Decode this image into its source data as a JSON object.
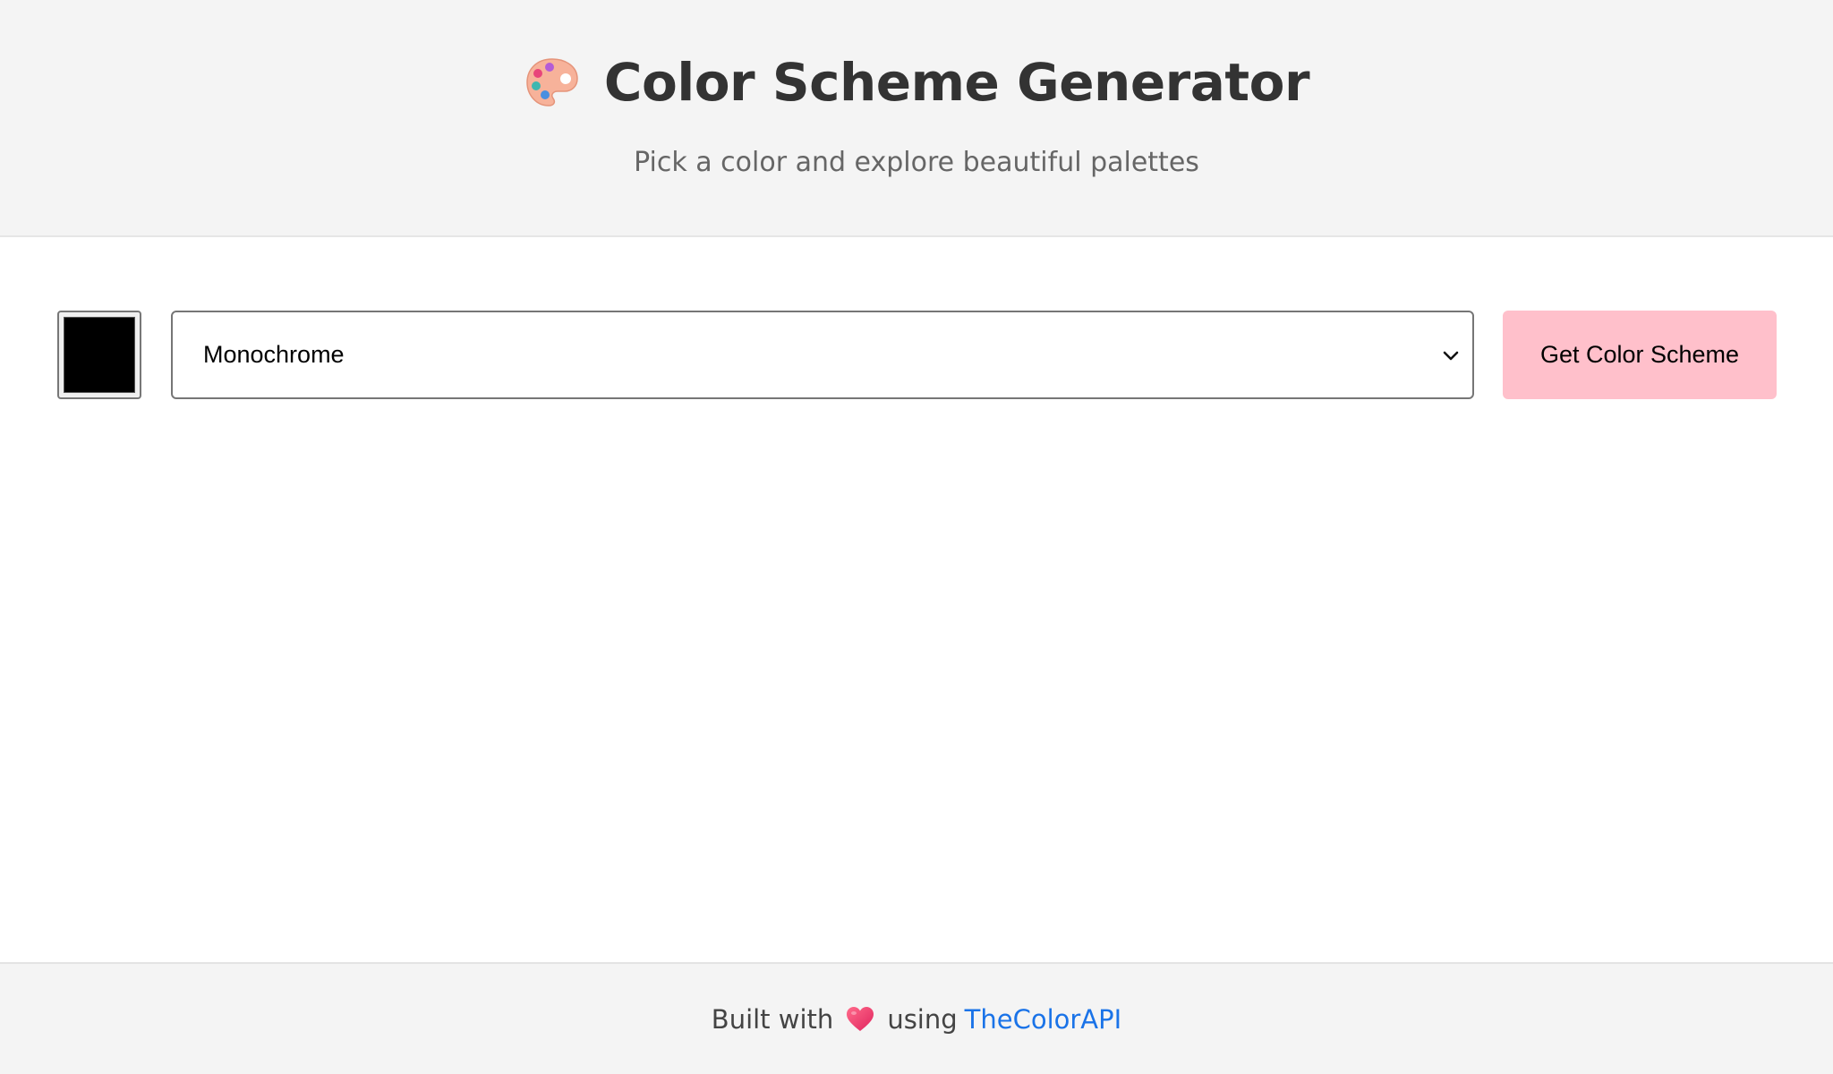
{
  "header": {
    "icon": "palette-icon",
    "title": "Color Scheme Generator",
    "subtitle": "Pick a color and explore beautiful palettes"
  },
  "controls": {
    "color_value": "#000000",
    "scheme_mode": {
      "selected": "Monochrome"
    },
    "button_label": "Get Color Scheme",
    "button_color": "#ffc0cb"
  },
  "footer": {
    "prefix": "Built with",
    "icon": "heart-icon",
    "middle": "using",
    "link_text": "TheColorAPI",
    "link_color": "#1a73e8"
  },
  "colors": {
    "header_bg": "#f4f4f4",
    "title": "#333333",
    "subtitle": "#666666"
  }
}
